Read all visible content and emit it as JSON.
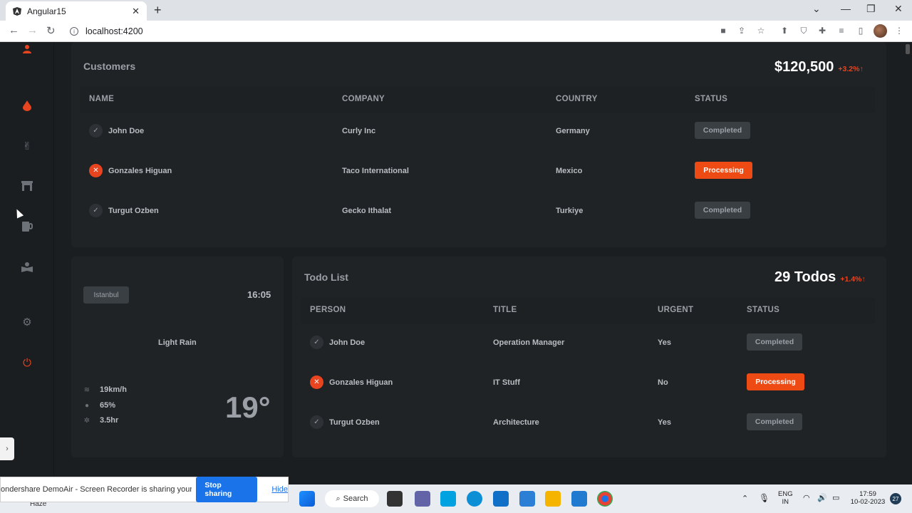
{
  "browser": {
    "tab_title": "Angular15",
    "url": "localhost:4200",
    "new_tab_icon": "plus-icon",
    "colors": {
      "tabstrip": "#dee1e6",
      "toolbar": "#ffffff"
    }
  },
  "sidebar": {
    "items": [
      {
        "name": "profile",
        "icon": "user-icon",
        "color": "#e8441f"
      },
      {
        "name": "fire",
        "icon": "drop-icon",
        "color": "#e8441f"
      },
      {
        "name": "victory",
        "icon": "hand-peace-icon",
        "color": "#6d7278"
      },
      {
        "name": "building",
        "icon": "archway-icon",
        "color": "#6d7278"
      },
      {
        "name": "mug",
        "icon": "mug-icon",
        "color": "#6d7278"
      },
      {
        "name": "reader",
        "icon": "book-reader-icon",
        "color": "#6d7278"
      },
      {
        "name": "settings",
        "icon": "gear-icon",
        "color": "#6d7278"
      },
      {
        "name": "logout",
        "icon": "power-icon",
        "color": "#e8441f"
      }
    ]
  },
  "customers": {
    "title": "Customers",
    "total": "$120,500",
    "delta": "+3.2%↑",
    "columns": [
      "NAME",
      "COMPANY",
      "COUNTRY",
      "STATUS"
    ],
    "rows": [
      {
        "name": "John Doe",
        "company": "Curly Inc",
        "country": "Germany",
        "status": "Completed",
        "state": "ok"
      },
      {
        "name": "Gonzales Higuan",
        "company": "Taco International",
        "country": "Mexico",
        "status": "Processing",
        "state": "err"
      },
      {
        "name": "Turgut Ozben",
        "company": "Gecko Ithalat",
        "country": "Turkiye",
        "status": "Completed",
        "state": "ok"
      }
    ]
  },
  "weather": {
    "city": "Istanbul",
    "time": "16:05",
    "condition": "Light Rain",
    "wind": "19km/h",
    "humidity": "65%",
    "sun": "3.5hr",
    "temperature": "19°"
  },
  "todos": {
    "title": "Todo List",
    "total": "29 Todos",
    "delta": "+1.4%↑",
    "columns": [
      "PERSON",
      "TITLE",
      "URGENT",
      "STATUS"
    ],
    "rows": [
      {
        "person": "John Doe",
        "title": "Operation Manager",
        "urgent": "Yes",
        "status": "Completed",
        "state": "ok"
      },
      {
        "person": "Gonzales Higuan",
        "title": "IT Stuff",
        "urgent": "No",
        "status": "Processing",
        "state": "err"
      },
      {
        "person": "Turgut Ozben",
        "title": "Architecture",
        "urgent": "Yes",
        "status": "Completed",
        "state": "ok"
      }
    ]
  },
  "share_bar": {
    "message": "ondershare DemoAir - Screen Recorder is sharing your screen.",
    "stop_label": "Stop sharing",
    "hide_label": "Hide"
  },
  "taskbar": {
    "weather": "Haze",
    "search_label": "Search",
    "lang": "ENG",
    "region": "IN",
    "time": "17:59",
    "date": "10-02-2023",
    "notifications": "27"
  },
  "colors": {
    "accent": "#e8441f",
    "processing": "#ee4b14",
    "background": "#1b1e21",
    "card": "#202326"
  }
}
